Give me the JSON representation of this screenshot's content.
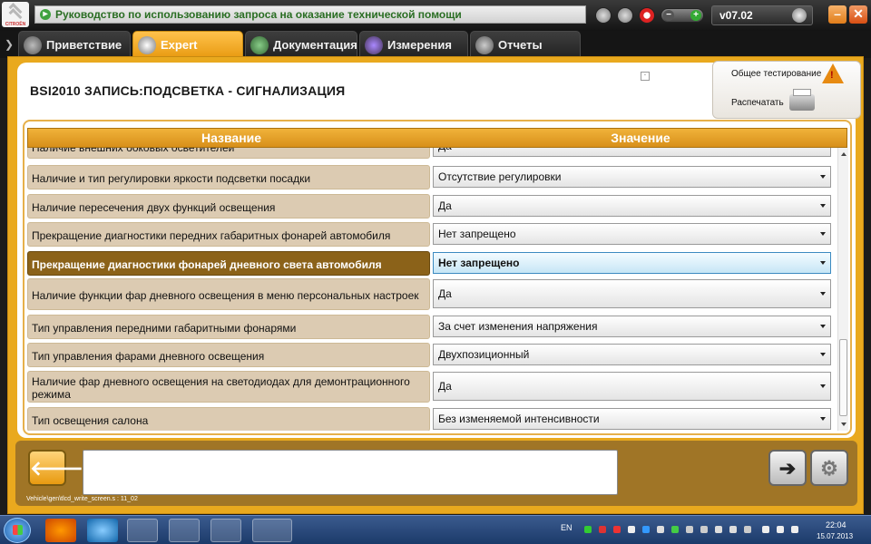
{
  "header": {
    "doc_title": "Руководство по использованию запроса на оказание технической помощи",
    "version": "v07.02",
    "logo_text": "CITROËN"
  },
  "tabs": [
    {
      "label": "Приветствие",
      "icon": "globe-icon",
      "active": false
    },
    {
      "label": "Expert",
      "icon": "magnifier-icon",
      "active": true
    },
    {
      "label": "Документация",
      "icon": "book-icon",
      "active": false
    },
    {
      "label": "Измерения",
      "icon": "wave-icon",
      "active": false
    },
    {
      "label": "Отчеты",
      "icon": "document-icon",
      "active": false
    }
  ],
  "page": {
    "title": "BSI2010  ЗАПИСЬ:ПОДСВЕТКА - СИГНАЛИЗАЦИЯ",
    "small_box": "·",
    "general_test_label": "Общее тестирование",
    "print_label": "Распечатать"
  },
  "table": {
    "col_name": "Название",
    "col_value": "Значение",
    "rows": [
      {
        "name": "Наличие внешних боковых осветителей",
        "value": "Да",
        "selected": false
      },
      {
        "name": "Наличие и тип регулировки яркости подсветки посадки",
        "value": "Отсутствие регулировки",
        "selected": false
      },
      {
        "name": "Наличие пересечения двух функций освещения",
        "value": "Да",
        "selected": false
      },
      {
        "name": "Прекращение диагностики передних габаритных фонарей автомобиля",
        "value": "Нет запрещено",
        "selected": false
      },
      {
        "name": "Прекращение диагностики фонарей дневного света автомобиля",
        "value": "Нет запрещено",
        "selected": true
      },
      {
        "name": "Наличие функции фар дневного освещения в меню персональных настроек",
        "value": "Да",
        "selected": false
      },
      {
        "name": "Тип управления передними габаритными фонарями",
        "value": "За счет изменения напряжения",
        "selected": false
      },
      {
        "name": "Тип управления фарами дневного освещения",
        "value": "Двухпозиционный",
        "selected": false
      },
      {
        "name": "Наличие фар дневного освещения на светодиодах для демонтрационного режима",
        "value": "Да",
        "selected": false
      },
      {
        "name": "Тип освещения салона",
        "value": "Без изменяемой интенсивности",
        "selected": false
      }
    ]
  },
  "footer": {
    "status_path": "Vehicle\\gen\\tlcd_write_screen.s : 11_02"
  },
  "taskbar": {
    "lang": "EN",
    "time": "22:04",
    "date": "15.07.2013"
  },
  "colors": {
    "accent_orange": "#e9a91e",
    "selected_row": "#8b6219",
    "name_cell_bg": "#dccbb2",
    "success_green": "#2a6e23"
  }
}
